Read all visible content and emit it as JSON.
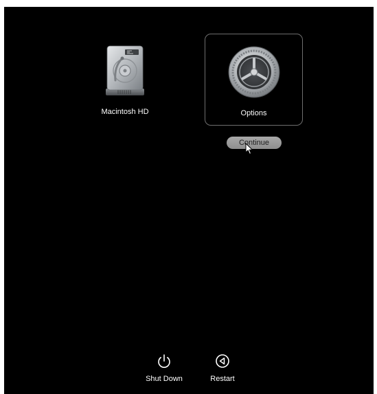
{
  "volumes": [
    {
      "label": "Macintosh HD",
      "icon": "hard-drive-icon",
      "selected": false
    },
    {
      "label": "Options",
      "icon": "gear-icon",
      "selected": true
    }
  ],
  "continue_button": {
    "label": "Continue"
  },
  "bottom_buttons": {
    "shutdown": {
      "label": "Shut Down",
      "icon": "power-icon"
    },
    "restart": {
      "label": "Restart",
      "icon": "restart-icon"
    }
  },
  "colors": {
    "background": "#000000",
    "text": "#ffffff",
    "selection_border": "#6f6f6f",
    "button_fill": "#9d9d9d"
  }
}
